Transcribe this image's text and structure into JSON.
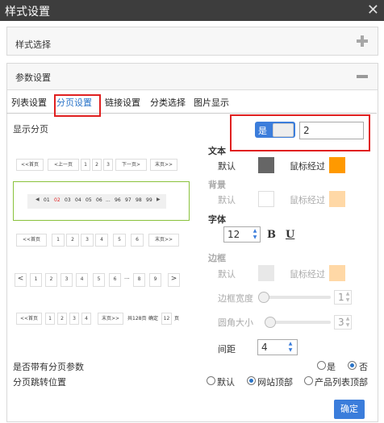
{
  "window": {
    "title": "样式设置"
  },
  "panels": {
    "style_select": "样式选择",
    "params": "参数设置"
  },
  "tabs": [
    "列表设置",
    "分页设置",
    "链接设置",
    "分类选择",
    "图片显示"
  ],
  "show_paging": {
    "label": "显示分页",
    "toggle_on": "是",
    "value": "2"
  },
  "text": {
    "title": "文本",
    "default": "默认",
    "hover": "鼠标经过",
    "default_color": "#666666",
    "hover_color": "#ff9900"
  },
  "background": {
    "title": "背景",
    "default": "默认",
    "hover": "鼠标经过",
    "default_color": "#ffffff",
    "hover_color": "#ffd8a6"
  },
  "font": {
    "title": "字体",
    "size": "12",
    "bold": "B",
    "underline": "U"
  },
  "border": {
    "title": "边框",
    "default": "默认",
    "hover": "鼠标经过",
    "default_color": "#e8e8e8",
    "hover_color": "#ffd8a6",
    "width_label": "边框宽度",
    "width_value": "1",
    "radius_label": "圆角大小",
    "radius_value": "3"
  },
  "spacing": {
    "label": "间距",
    "value": "4"
  },
  "paging_params": {
    "label": "是否带有分页参数",
    "yes": "是",
    "no": "否"
  },
  "jump": {
    "label": "分页跳转位置",
    "default": "默认",
    "site_top": "网站顶部",
    "product_top": "产品列表顶部"
  },
  "confirm": "确定",
  "pagers": {
    "p1": [
      "<<首页",
      "<上一页",
      "1",
      "2",
      "3",
      "下一页>",
      "末页>>"
    ],
    "p2": [
      "◀",
      "01",
      "02",
      "03",
      "04",
      "05",
      "06",
      "...",
      "96",
      "97",
      "98",
      "99",
      "▶"
    ],
    "p3": [
      "<<首页",
      "1",
      "2",
      "3",
      "4",
      "5",
      "6",
      "末页>>"
    ],
    "p4": [
      "<",
      "1",
      "2",
      "3",
      "4",
      "5",
      "6",
      "...",
      "8",
      "9",
      ">"
    ],
    "p5": [
      "<<首页",
      "1",
      "2",
      "3",
      "4",
      "末页>>",
      "共128页",
      "确定",
      "12",
      "页"
    ]
  },
  "colors": {
    "accent": "#3b7ddb",
    "highlight": "#e02020"
  }
}
